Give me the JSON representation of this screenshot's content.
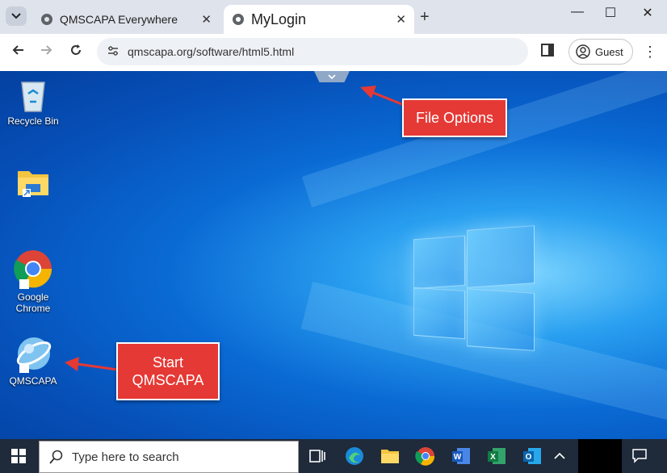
{
  "browser": {
    "tabs": [
      {
        "label": "QMSCAPA Everywhere",
        "active": false
      },
      {
        "label": "MyLogin",
        "active": true
      }
    ],
    "url": "qmscapa.org/software/html5.html",
    "profile_label": "Guest"
  },
  "desktop": {
    "icons": [
      {
        "label": "Recycle Bin",
        "icon": "recycle-bin-icon"
      },
      {
        "label": "",
        "icon": "file-explorer-folder-icon"
      },
      {
        "label": "Google Chrome",
        "icon": "chrome-icon"
      },
      {
        "label": "QMSCAPA",
        "icon": "qmscapa-globe-icon"
      }
    ]
  },
  "callouts": {
    "file_options": "File Options",
    "start_qmscapa": "Start QMSCAPA"
  },
  "taskbar": {
    "search_placeholder": "Type here to search",
    "apps": [
      "task-view-icon",
      "edge-icon",
      "file-explorer-icon",
      "chrome-icon",
      "word-icon",
      "excel-icon",
      "outlook-icon"
    ]
  },
  "colors": {
    "callout_red": "#e53935",
    "taskbar": "#1f2a3a",
    "desktop_blue": "#0a6ad4"
  }
}
